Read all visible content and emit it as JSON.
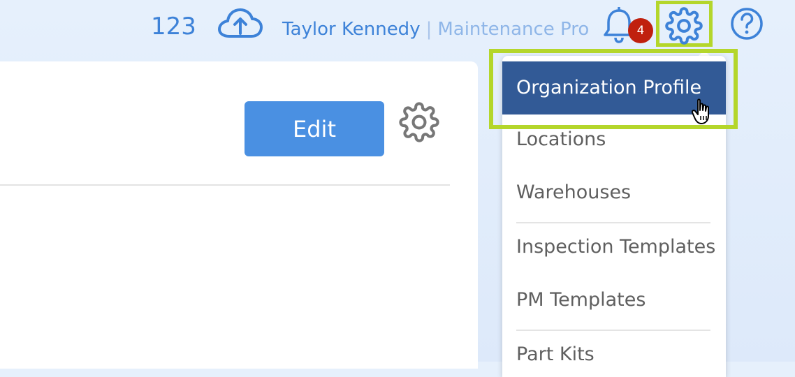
{
  "header": {
    "count": "123",
    "user_name": "Taylor Kennedy",
    "separator": "|",
    "plan": "Maintenance Pro",
    "notification_count": "4"
  },
  "card": {
    "edit_label": "Edit"
  },
  "settings_menu": {
    "items": [
      {
        "label": "Organization Profile",
        "active": true
      },
      {
        "label": "Locations"
      },
      {
        "label": "Warehouses"
      },
      {
        "label": "Inspection Templates"
      },
      {
        "label": "PM Templates"
      },
      {
        "label": "Part Kits"
      }
    ]
  },
  "colors": {
    "accent": "#3d82d8",
    "button": "#4a90e2",
    "menu_active": "#325a96",
    "highlight": "#b4d62b",
    "badge": "#c0200e"
  },
  "icons": {
    "upload": "cloud-upload-icon",
    "notifications": "bell-icon",
    "settings": "gear-icon",
    "help": "help-icon"
  }
}
